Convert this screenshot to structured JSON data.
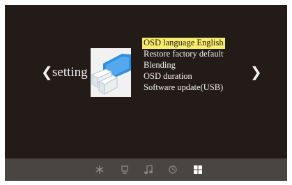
{
  "screen": {
    "title": "setting",
    "nav": {
      "prev_glyph": "❮",
      "next_glyph": "❯"
    },
    "category_icon": "settings-tiles-icon",
    "menu_items": [
      {
        "label": "OSD language English",
        "selected": true
      },
      {
        "label": "Restore factory default",
        "selected": false
      },
      {
        "label": "Blending",
        "selected": false
      },
      {
        "label": "OSD duration",
        "selected": false
      },
      {
        "label": "Software update(USB)",
        "selected": false
      }
    ]
  },
  "dock": {
    "items": [
      {
        "icon": "snowflake-icon",
        "active": false
      },
      {
        "icon": "monitor-icon",
        "active": false
      },
      {
        "icon": "music-note-icon",
        "active": false
      },
      {
        "icon": "clock-icon",
        "active": false
      },
      {
        "icon": "windows-grid-icon",
        "active": true
      }
    ]
  },
  "colors": {
    "background": "#231b18",
    "dock": "#4a4542",
    "highlight": "#f7ec6e",
    "text": "#f4f4f4",
    "dock_icon": "#8a8582",
    "dock_icon_active": "#ffffff",
    "icon_blue": "#2f8fe0"
  }
}
